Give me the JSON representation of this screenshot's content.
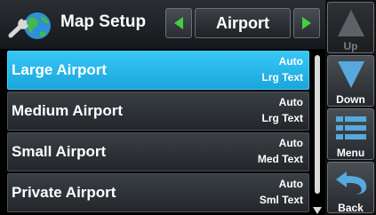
{
  "header": {
    "title": "Map Setup",
    "selector_value": "Airport",
    "icon": "wrench-globe-icon"
  },
  "list": {
    "rows": [
      {
        "label": "Large Airport",
        "value1": "Auto",
        "value2": "Lrg Text",
        "active": true
      },
      {
        "label": "Medium Airport",
        "value1": "Auto",
        "value2": "Lrg Text",
        "active": false
      },
      {
        "label": "Small Airport",
        "value1": "Auto",
        "value2": "Med Text",
        "active": false
      },
      {
        "label": "Private Airport",
        "value1": "Auto",
        "value2": "Sml Text",
        "active": false
      }
    ]
  },
  "softkeys": {
    "up": "Up",
    "down": "Down",
    "menu": "Menu",
    "back": "Back"
  },
  "colors": {
    "accent": "#22b3e8",
    "arrow_green": "#3fd13f",
    "key_blue": "#56a9dc"
  }
}
